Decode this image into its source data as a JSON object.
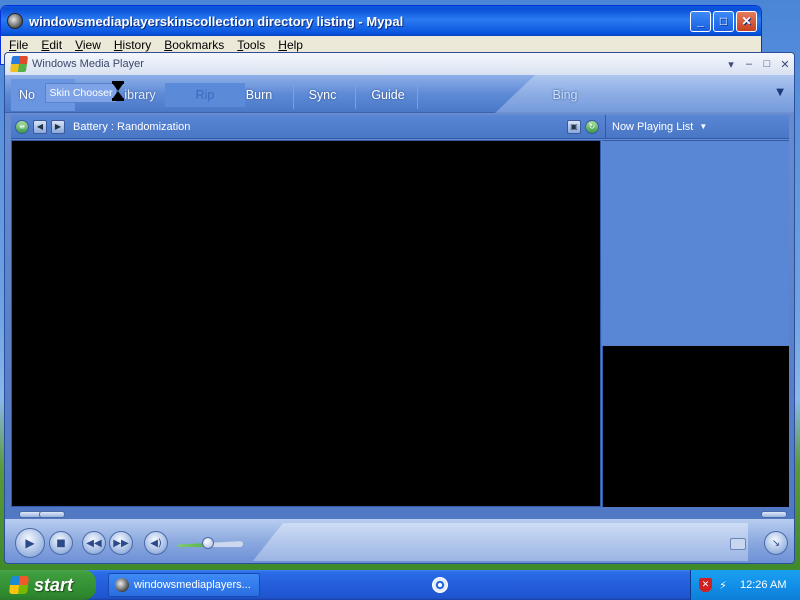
{
  "browser": {
    "title": "windowsmediaplayerskinscollection directory listing - Mypal",
    "menu": [
      "File",
      "Edit",
      "View",
      "History",
      "Bookmarks",
      "Tools",
      "Help"
    ],
    "buttons": {
      "minimize": "_",
      "maximize": "□",
      "close": "✕"
    }
  },
  "wmp": {
    "title": "Windows Media Player",
    "title_controls": {
      "menu": "▾",
      "minimize": "–",
      "maximize": "□",
      "close": "✕"
    },
    "tabs": {
      "now_playing": "No",
      "library": "ibrary",
      "rip": "Rip",
      "burn": "Burn",
      "sync": "Sync",
      "guide": "Guide",
      "bing": "Bing"
    },
    "tooltip": "Skin Chooser",
    "info_text": "Battery : Randomization",
    "now_playing_list": "Now Playing List"
  },
  "taskbar": {
    "start_label": "start",
    "task_item": "windowsmediaplayers...",
    "clock": "12:26 AM"
  },
  "colors": {
    "xp_blue": "#245edb",
    "start_green": "#2f8a2f",
    "wmp_blue": "#4a76c6"
  },
  "icons": [
    "hourglass-icon",
    "play-icon",
    "stop-icon",
    "prev-icon",
    "next-icon",
    "mute-icon",
    "shield-icon",
    "network-icon"
  ]
}
